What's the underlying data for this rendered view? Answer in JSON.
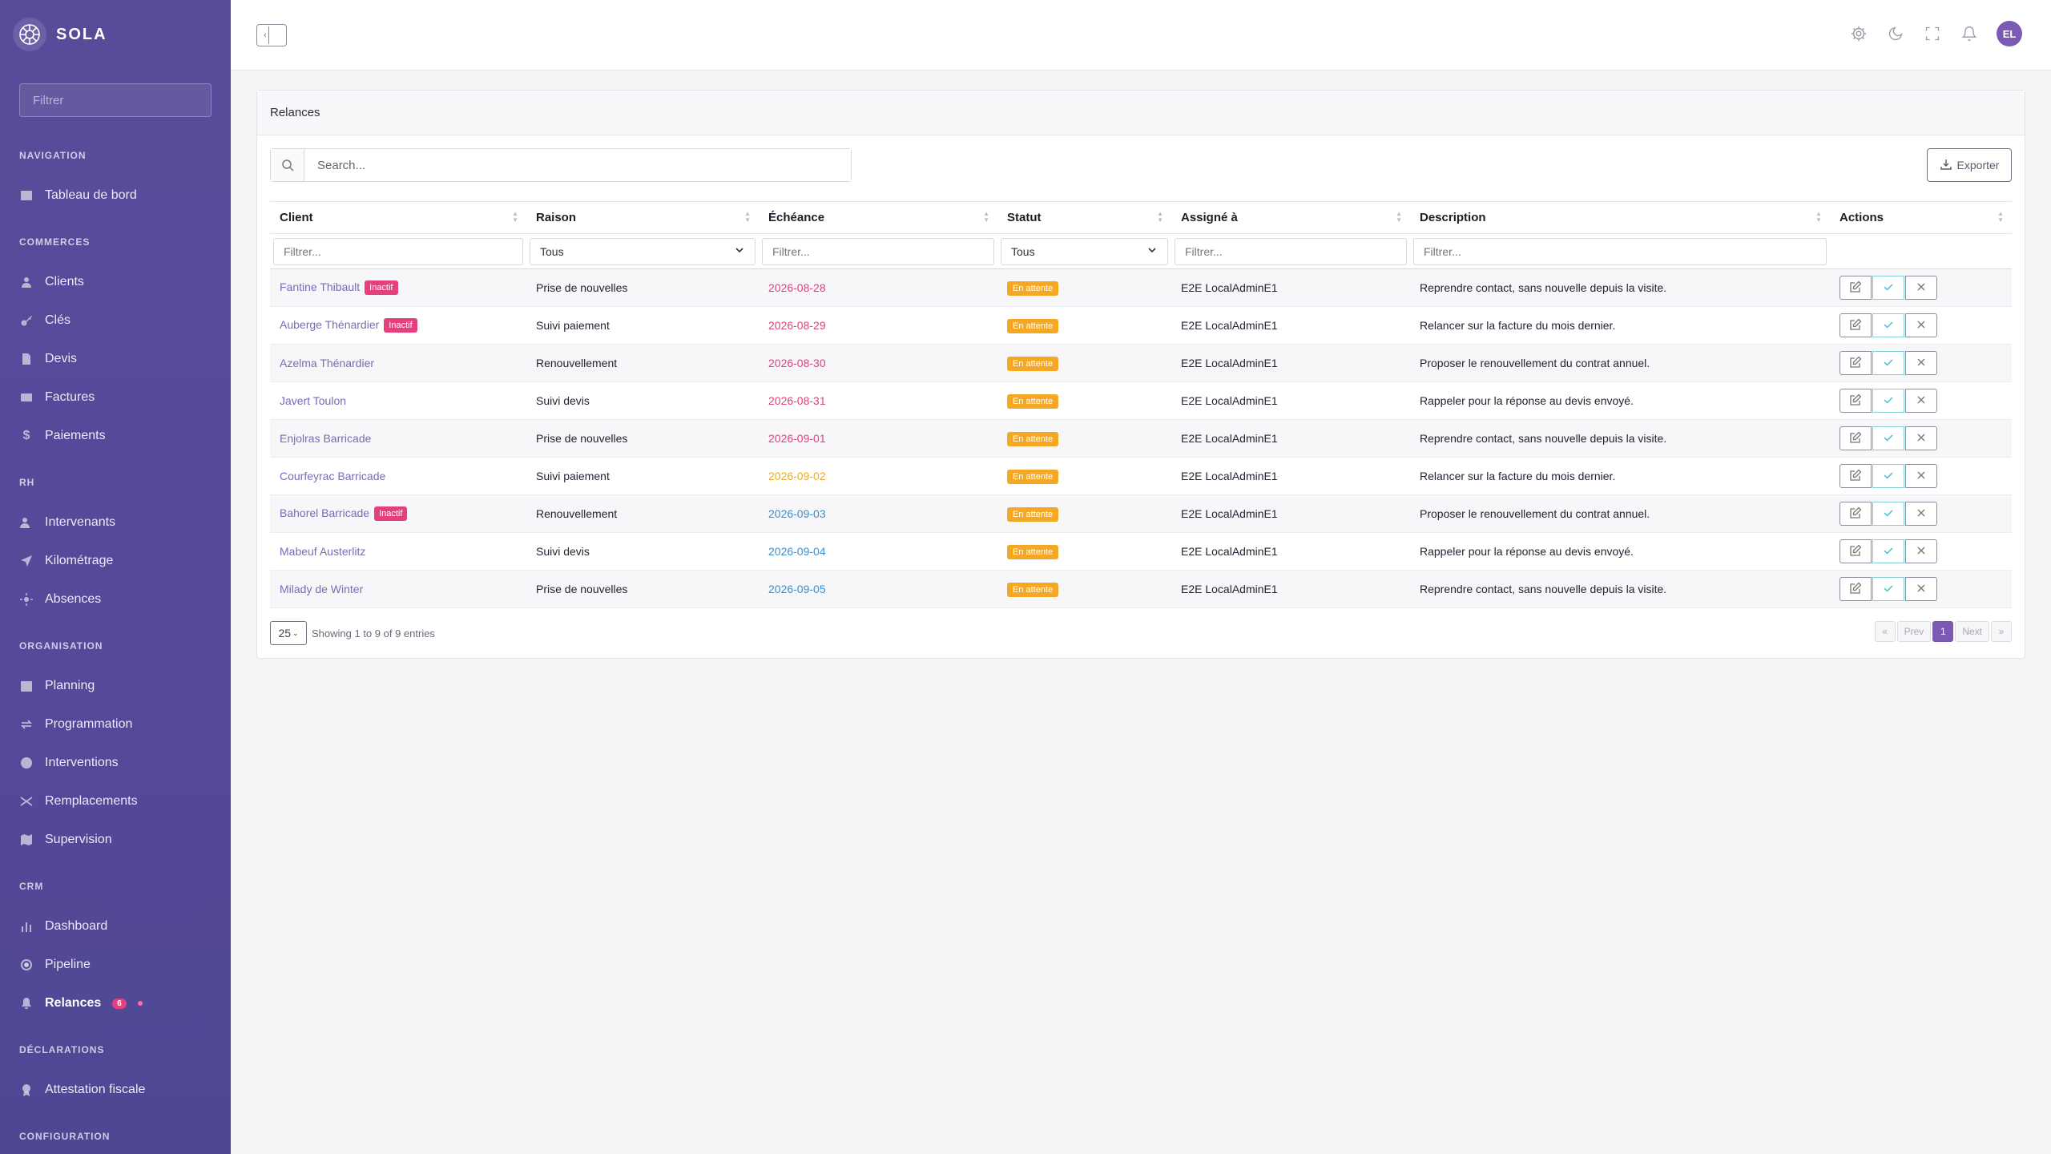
{
  "brand": {
    "name": "SOLA"
  },
  "sidebar": {
    "filter_placeholder": "Filtrer",
    "sections": {
      "navigation": "NAVIGATION",
      "commerces": "COMMERCES",
      "rh": "RH",
      "organisation": "ORGANISATION",
      "crm": "CRM",
      "declarations": "DÉCLARATIONS",
      "configuration": "CONFIGURATION"
    },
    "items": {
      "tableau": "Tableau de bord",
      "clients": "Clients",
      "cles": "Clés",
      "devis": "Devis",
      "factures": "Factures",
      "paiements": "Paiements",
      "intervenants": "Intervenants",
      "kilometrage": "Kilométrage",
      "absences": "Absences",
      "planning": "Planning",
      "programmation": "Programmation",
      "interventions": "Interventions",
      "remplacements": "Remplacements",
      "supervision": "Supervision",
      "dashboard": "Dashboard",
      "pipeline": "Pipeline",
      "relances": "Relances",
      "relances_badge": "6",
      "attestation": "Attestation fiscale"
    }
  },
  "topbar": {
    "avatar_initials": "EL"
  },
  "card": {
    "title": "Relances",
    "search_placeholder": "Search...",
    "export_label": "Exporter"
  },
  "table": {
    "columns": {
      "client": "Client",
      "raison": "Raison",
      "echeance": "Échéance",
      "statut": "Statut",
      "assigne": "Assigné à",
      "description": "Description",
      "actions": "Actions"
    },
    "filter_placeholder": "Filtrer...",
    "select_all": "Tous",
    "colors": {
      "overdue": "#d9437f",
      "soon": "#f0ac1e",
      "future": "#3d8fc9",
      "status": "#f5a823",
      "inactive": "#e4407e"
    },
    "inactive_label": "Inactif",
    "status_label": "En attente",
    "rows": [
      {
        "client": "Fantine Thibault",
        "inactive": true,
        "raison": "Prise de nouvelles",
        "date": "2026-08-28",
        "date_kind": "overdue",
        "assigne": "E2E LocalAdminE1",
        "description": "Reprendre contact, sans nouvelle depuis la visite."
      },
      {
        "client": "Auberge Thénardier",
        "inactive": true,
        "raison": "Suivi paiement",
        "date": "2026-08-29",
        "date_kind": "overdue",
        "assigne": "E2E LocalAdminE1",
        "description": "Relancer sur la facture du mois dernier."
      },
      {
        "client": "Azelma Thénardier",
        "inactive": false,
        "raison": "Renouvellement",
        "date": "2026-08-30",
        "date_kind": "overdue",
        "assigne": "E2E LocalAdminE1",
        "description": "Proposer le renouvellement du contrat annuel."
      },
      {
        "client": "Javert Toulon",
        "inactive": false,
        "raison": "Suivi devis",
        "date": "2026-08-31",
        "date_kind": "overdue",
        "assigne": "E2E LocalAdminE1",
        "description": "Rappeler pour la réponse au devis envoyé."
      },
      {
        "client": "Enjolras Barricade",
        "inactive": false,
        "raison": "Prise de nouvelles",
        "date": "2026-09-01",
        "date_kind": "overdue",
        "assigne": "E2E LocalAdminE1",
        "description": "Reprendre contact, sans nouvelle depuis la visite."
      },
      {
        "client": "Courfeyrac Barricade",
        "inactive": false,
        "raison": "Suivi paiement",
        "date": "2026-09-02",
        "date_kind": "soon",
        "assigne": "E2E LocalAdminE1",
        "description": "Relancer sur la facture du mois dernier."
      },
      {
        "client": "Bahorel Barricade",
        "inactive": true,
        "raison": "Renouvellement",
        "date": "2026-09-03",
        "date_kind": "future",
        "assigne": "E2E LocalAdminE1",
        "description": "Proposer le renouvellement du contrat annuel."
      },
      {
        "client": "Mabeuf Austerlitz",
        "inactive": false,
        "raison": "Suivi devis",
        "date": "2026-09-04",
        "date_kind": "future",
        "assigne": "E2E LocalAdminE1",
        "description": "Rappeler pour la réponse au devis envoyé."
      },
      {
        "client": "Milady de Winter",
        "inactive": false,
        "raison": "Prise de nouvelles",
        "date": "2026-09-05",
        "date_kind": "future",
        "assigne": "E2E LocalAdminE1",
        "description": "Reprendre contact, sans nouvelle depuis la visite."
      }
    ]
  },
  "footer": {
    "page_size": "25",
    "showing": "Showing 1 to 9 of 9 entries",
    "first": "«",
    "prev": "Prev",
    "current": "1",
    "next": "Next",
    "last": "»"
  }
}
